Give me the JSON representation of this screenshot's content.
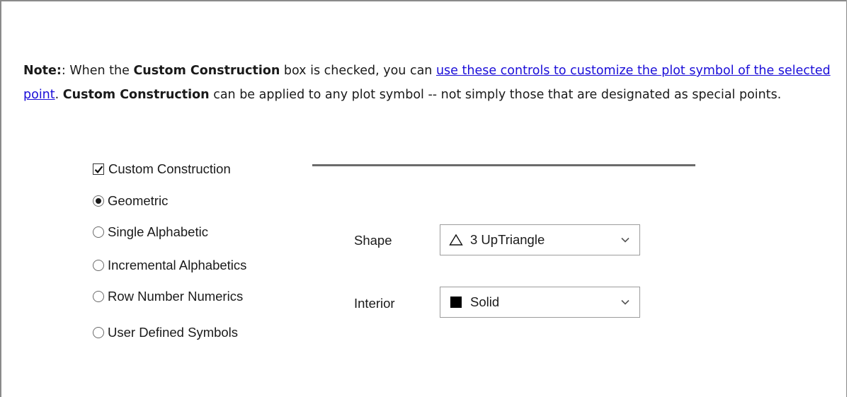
{
  "note": {
    "label": "Note:",
    "after_label": ": When the ",
    "term1": "Custom Construction",
    "mid1": " box is checked, you can ",
    "link_text": "use these controls to customize the plot symbol of the selected point",
    "mid2": ". ",
    "term2": "Custom Construction",
    "rest": " can be applied to any plot symbol -- not simply those that are designated as special points."
  },
  "custom_construction": {
    "label": "Custom Construction",
    "checked": true
  },
  "symbol_type": {
    "options": [
      {
        "label": "Geometric",
        "selected": true
      },
      {
        "label": "Single Alphabetic",
        "selected": false
      },
      {
        "label": "Incremental Alphabetics",
        "selected": false
      },
      {
        "label": "Row Number Numerics",
        "selected": false
      },
      {
        "label": "User Defined Symbols",
        "selected": false
      }
    ]
  },
  "shape": {
    "label": "Shape",
    "value": "3 UpTriangle",
    "icon": "up-triangle-icon"
  },
  "interior": {
    "label": "Interior",
    "value": "Solid",
    "icon": "solid-square-icon"
  }
}
